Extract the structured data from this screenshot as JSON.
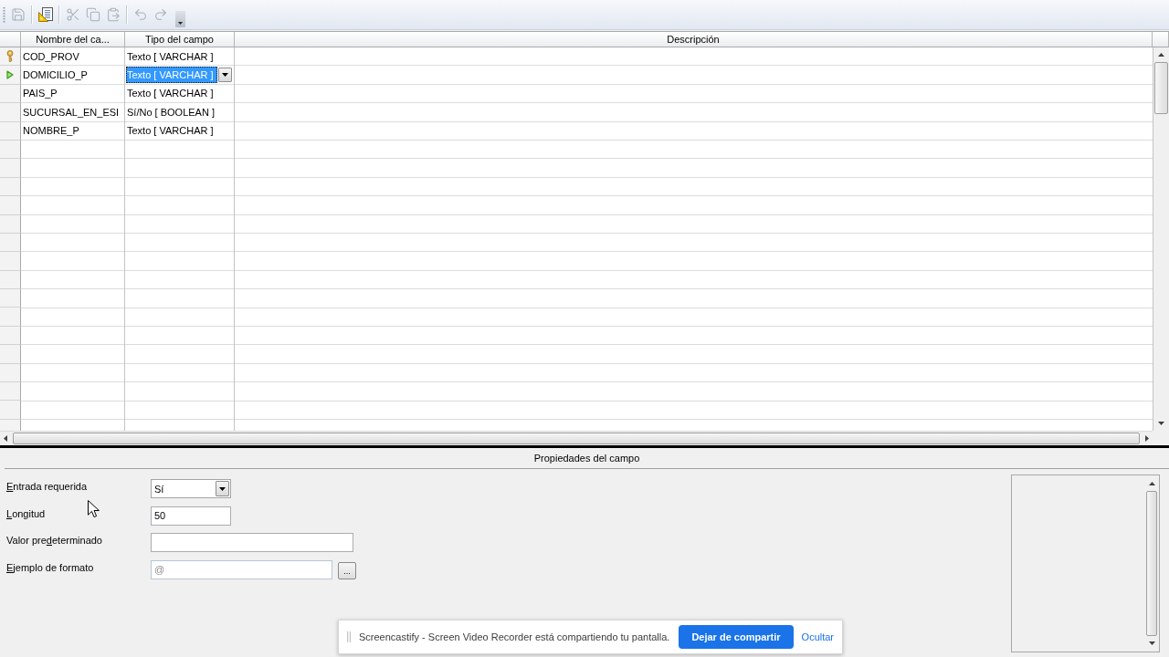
{
  "toolbar": {
    "buttons": [
      {
        "disabled": true
      },
      {
        "disabled": false
      },
      {
        "disabled": true
      },
      {
        "disabled": true
      },
      {
        "disabled": true
      },
      {
        "disabled": true
      },
      {
        "disabled": true
      }
    ]
  },
  "table": {
    "columns": [
      "Nombre del ca...",
      "Tipo del campo",
      "Descripción"
    ],
    "rows": [
      {
        "name": "COD_PROV",
        "type": "Texto [ VARCHAR ]",
        "primary_key": true,
        "current": false,
        "editing": false
      },
      {
        "name": "DOMICILIO_P",
        "type": "Texto [ VARCHAR ]",
        "primary_key": false,
        "current": true,
        "editing": true
      },
      {
        "name": "PAIS_P",
        "type": "Texto [ VARCHAR ]",
        "primary_key": false,
        "current": false,
        "editing": false
      },
      {
        "name": "SUCURSAL_EN_ESI",
        "type": "Sí/No [ BOOLEAN ]",
        "primary_key": false,
        "current": false,
        "editing": false
      },
      {
        "name": "NOMBRE_P",
        "type": "Texto [ VARCHAR ]",
        "primary_key": false,
        "current": false,
        "editing": false
      }
    ]
  },
  "field_properties": {
    "title": "Propiedades del campo",
    "fields": [
      {
        "kind": "select",
        "label": {
          "mnemonic": "E",
          "after": "ntrada requerida"
        },
        "value": "Sí"
      },
      {
        "kind": "number",
        "label": {
          "mnemonic": "L",
          "after": "ongitud"
        },
        "value": "50"
      },
      {
        "kind": "text",
        "label": {
          "before": "Valor pre",
          "mnemonic": "d",
          "after": "eterminado"
        }
      },
      {
        "kind": "format",
        "label": {
          "mnemonic": "E",
          "after": "jemplo de formato"
        },
        "value": "@",
        "read_only": true,
        "button": "..."
      }
    ]
  },
  "share_notification": {
    "message": "Screencastify - Screen Video Recorder está compartiendo tu pantalla.",
    "stop_button": "Dejar de compartir",
    "hide_link": "Ocultar"
  }
}
